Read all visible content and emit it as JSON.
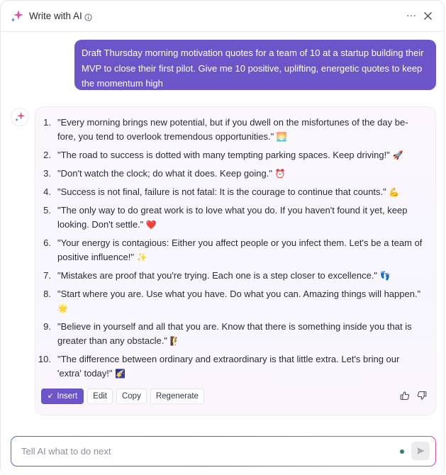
{
  "header": {
    "title": "Write with AI",
    "more_label": "···"
  },
  "user_message": "Draft Thursday morning motivation quotes for a team of 10 at a startup building their MVP to close their first pilot. Give me 10 positive, uplifting, energetic quotes to keep the momentum high",
  "ai_response": {
    "quotes": [
      {
        "num": "1.",
        "text": "\"Every morning brings new potential, but if you dwell on the misfortunes of the day be-fore, you tend to overlook tremendous opportunities.\"",
        "emoji": "🌅"
      },
      {
        "num": "2.",
        "text": "\"The road to success is dotted with many tempting parking spaces. Keep driving!\"",
        "emoji": "🚀"
      },
      {
        "num": "3.",
        "text": "\"Don't watch the clock; do what it does. Keep going.\"",
        "emoji": "⏰"
      },
      {
        "num": "4.",
        "text": "\"Success is not final, failure is not fatal: It is the courage to continue that counts.\"",
        "emoji": "💪"
      },
      {
        "num": "5.",
        "text": "\"The only way to do great work is to love what you do. If you haven't found it yet, keep looking. Don't settle.\"",
        "emoji": "❤️"
      },
      {
        "num": "6.",
        "text": "\"Your energy is contagious: Either you affect people or you infect them. Let's be a team of positive influence!\"",
        "emoji": "✨"
      },
      {
        "num": "7.",
        "text": "\"Mistakes are proof that you're trying. Each one is a step closer to excellence.\"",
        "emoji": "👣"
      },
      {
        "num": "8.",
        "text": "\"Start where you are. Use what you have. Do what you can. Amazing things will happen.\"",
        "emoji": "🌟"
      },
      {
        "num": "9.",
        "text": "\"Believe in yourself and all that you are. Know that there is something inside you that is greater than any obstacle.\"",
        "emoji": "🧗"
      },
      {
        "num": "10.",
        "text": "\"The difference between ordinary and extraordinary is that little extra. Let's bring our 'extra' today!\"",
        "emoji": "🌠"
      }
    ],
    "actions": {
      "insert_label": "Insert",
      "insert_icon": "↙",
      "edit_label": "Edit",
      "copy_label": "Copy",
      "regenerate_label": "Regenerate"
    }
  },
  "composer": {
    "placeholder": "Tell AI what to do next",
    "value": ""
  },
  "colors": {
    "accent": "#6b55c8",
    "status_dot": "#2e7d6e"
  }
}
